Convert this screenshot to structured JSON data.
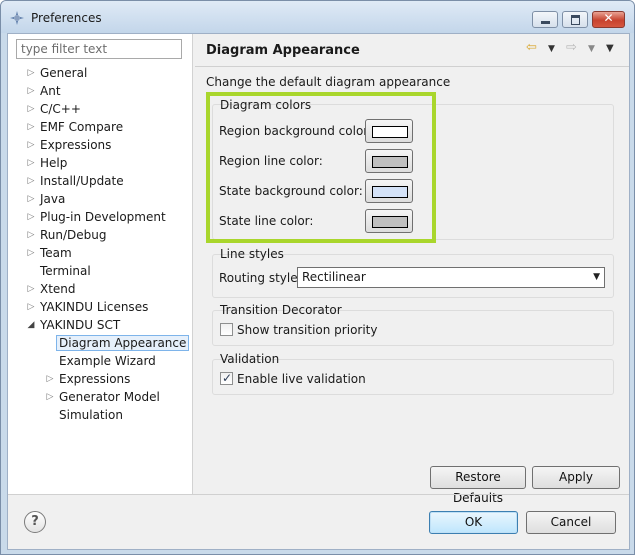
{
  "window": {
    "title": "Preferences",
    "close_glyph": "✕"
  },
  "filter": {
    "placeholder": "type filter text"
  },
  "tree": {
    "items": [
      {
        "label": "General"
      },
      {
        "label": "Ant"
      },
      {
        "label": "C/C++"
      },
      {
        "label": "EMF Compare"
      },
      {
        "label": "Expressions"
      },
      {
        "label": "Help"
      },
      {
        "label": "Install/Update"
      },
      {
        "label": "Java"
      },
      {
        "label": "Plug-in Development"
      },
      {
        "label": "Run/Debug"
      },
      {
        "label": "Team"
      },
      {
        "label": "Terminal"
      },
      {
        "label": "Xtend"
      },
      {
        "label": "YAKINDU Licenses"
      },
      {
        "label": "YAKINDU SCT"
      },
      {
        "label": "Diagram Appearance"
      },
      {
        "label": "Example Wizard"
      },
      {
        "label": "Expressions"
      },
      {
        "label": "Generator Model"
      },
      {
        "label": "Simulation"
      }
    ]
  },
  "page": {
    "title": "Diagram Appearance",
    "description": "Change the default diagram appearance"
  },
  "nav": {
    "back_icon": "⇦",
    "forward_icon": "⇨",
    "dropdown_icon": "▼"
  },
  "diagram_colors": {
    "title": "Diagram colors",
    "rows": [
      {
        "label": "Region background color:",
        "color": "#ffffff"
      },
      {
        "label": "Region line color:",
        "color": "#c0c0c0"
      },
      {
        "label": "State background color:",
        "color": "#d4e2f7"
      },
      {
        "label": "State line color:",
        "color": "#c0c0c0"
      }
    ],
    "highlight_color": "#a9d62c"
  },
  "line_styles": {
    "title": "Line styles",
    "routing_label": "Routing style",
    "routing_value": "Rectilinear"
  },
  "transition_decorator": {
    "title": "Transition Decorator",
    "show_priority_label": "Show transition priority",
    "show_priority_checked": false
  },
  "validation": {
    "title": "Validation",
    "live_label": "Enable live validation",
    "live_checked": true
  },
  "buttons": {
    "restore_defaults": "Restore Defaults",
    "apply": "Apply",
    "ok": "OK",
    "cancel": "Cancel",
    "help": "?"
  }
}
